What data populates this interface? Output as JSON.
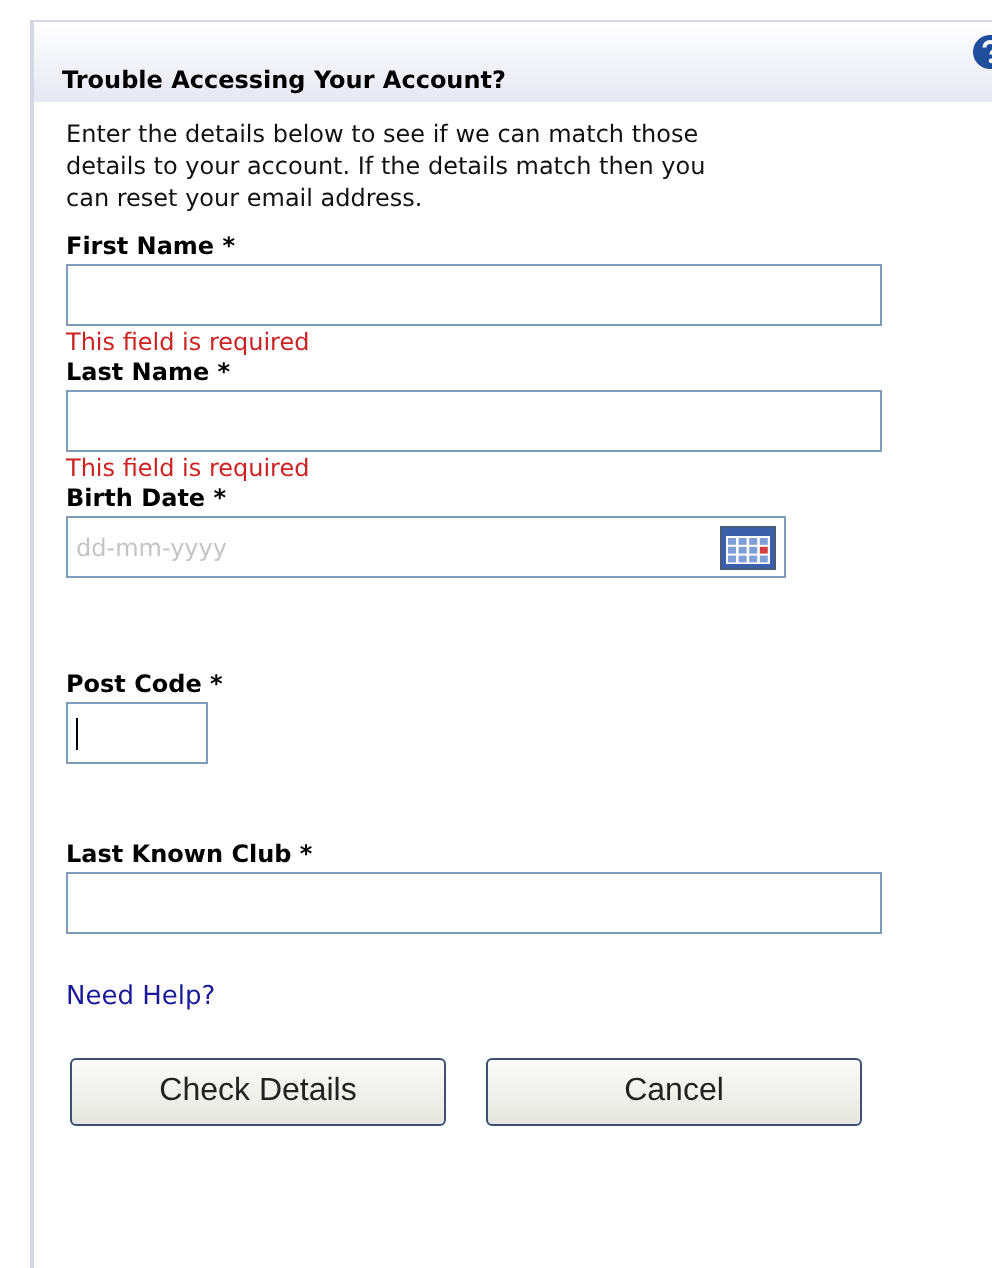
{
  "panel": {
    "title": "Trouble Accessing Your Account?",
    "intro": "Enter the details below to see if we can match those details to your account. If the details match then you can reset your email address."
  },
  "fields": [
    {
      "kind": "text",
      "label": "First Name *",
      "error": "This field is required",
      "focused": false
    },
    {
      "kind": "text",
      "label": "Last Name *",
      "error": "This field is required",
      "focused": false
    },
    {
      "kind": "date",
      "label": "Birth Date *",
      "placeholder": "dd-mm-yyyy",
      "focused": false
    },
    {
      "kind": "short",
      "label": "Post Code *",
      "focused": true
    },
    {
      "kind": "text",
      "label": "Last Known Club *",
      "focused": false
    }
  ],
  "help_link": "Need Help?",
  "buttons": [
    "Check Details",
    "Cancel"
  ]
}
